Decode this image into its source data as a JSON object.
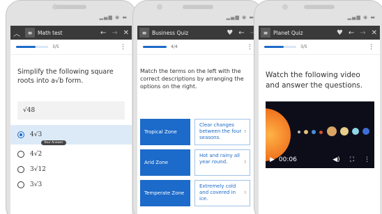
{
  "phones": [
    {
      "title": "Math test",
      "progress": "3/5",
      "progress_fraction": 0.6,
      "question": "Simplify the following square roots into a√b form.",
      "expression": "√48",
      "options": [
        "4√3",
        "4√2",
        "3√12",
        "3√3"
      ],
      "selected_index": 0,
      "tooltip": "Your Answer"
    },
    {
      "title": "Business Quiz",
      "progress": "4/4",
      "progress_fraction": 1.0,
      "question": "Match the terms on the left with the correct descriptions by arranging the options on the right.",
      "pairs": [
        {
          "term": "Tropical Zone",
          "description": "Clear changes between the four seasons."
        },
        {
          "term": "Arid Zone",
          "description": "Hot and rainy all year round."
        },
        {
          "term": "Temperate Zone",
          "description": "Extremely cold and covered in ice."
        }
      ]
    },
    {
      "title": "Planet Quiz",
      "progress": "3/5",
      "progress_fraction": 0.6,
      "question": "Watch the following video and answer the questions.",
      "video_time": "00:06"
    }
  ],
  "colors": {
    "accent": "#1c6ac9",
    "topbar": "#3a3a3a",
    "selected_bg": "#dceaf8"
  },
  "icons": [
    "chevron-up-icon",
    "menu-icon",
    "back-arrow-icon",
    "forward-arrow-icon",
    "close-icon",
    "heart-icon",
    "more-vert-icon",
    "play-icon",
    "volume-icon",
    "fullscreen-icon"
  ]
}
